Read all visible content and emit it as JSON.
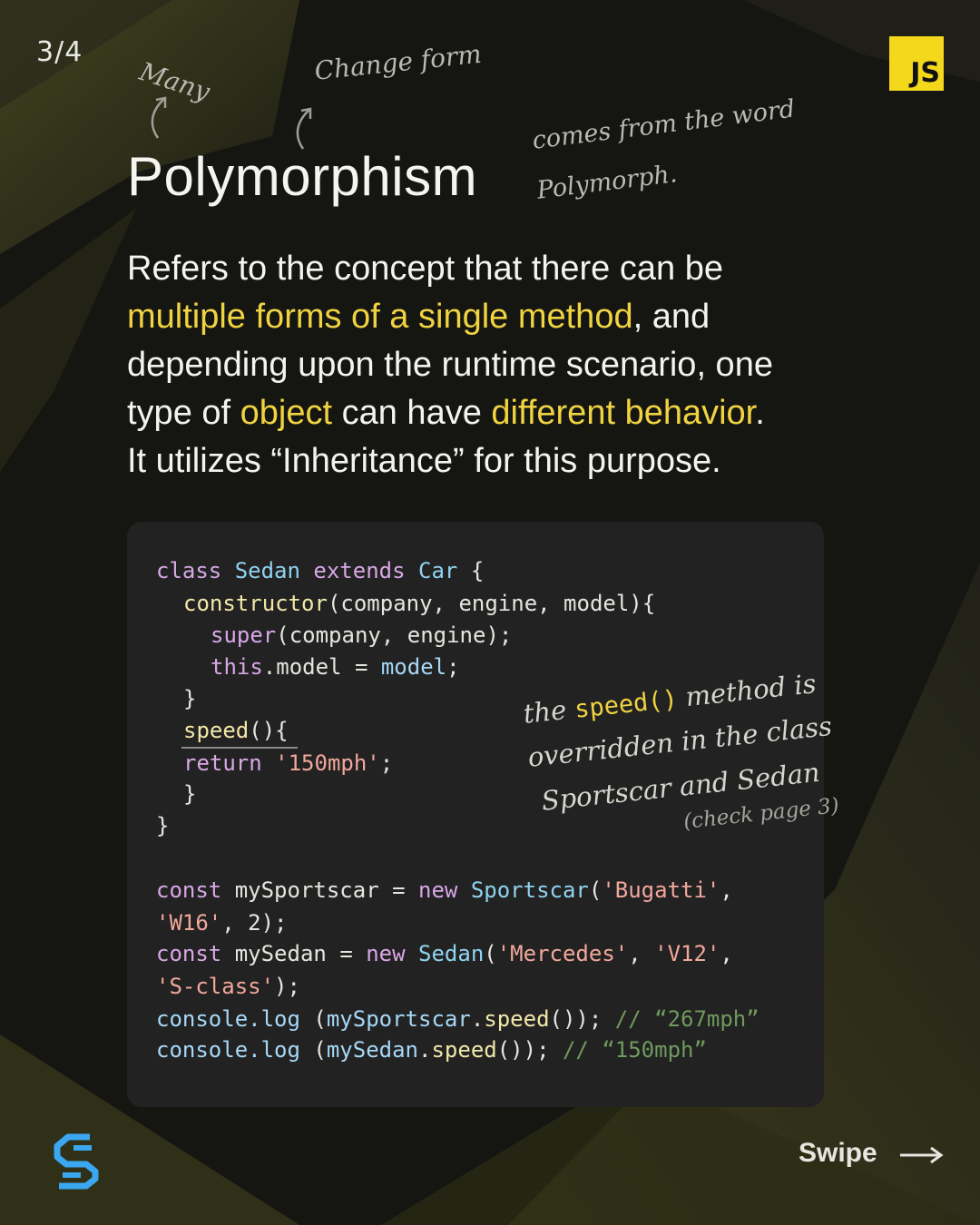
{
  "page_indicator": "3/4",
  "badge": "JS",
  "annotations": {
    "many": "Many",
    "change_form": "Change form",
    "origin_line1": "comes from the word",
    "origin_line2": "Polymorph."
  },
  "title": "Polymorphism",
  "body": {
    "p1": "Refers to the concept that there can be",
    "h1": "multiple forms of a single method",
    "p2": ", and",
    "p3": "depending upon the runtime scenario, one",
    "p4": "type of ",
    "h2": "object",
    "p5": " can have ",
    "h3": "different behavior",
    "p6": ".",
    "p7": "It utilizes “Inheritance” for this purpose."
  },
  "code": {
    "kw_class": "class",
    "name_sedan": "Sedan",
    "kw_extends": "extends",
    "name_car": "Car",
    "brace_open": "{",
    "fn_constructor": "constructor",
    "params": "(company, engine, model){",
    "kw_super": "super",
    "super_args": "(company, engine);",
    "kw_this": "this",
    "this_rest": ".model = ",
    "var_model": "model",
    "semicolon": ";",
    "brace_close": "}",
    "fn_speed": "speed",
    "speed_parens": "(){",
    "kw_return": "return",
    "str_150": "'150mph'",
    "kw_const": "const",
    "var_mysportscar": "mySportscar",
    "op_assign": "=",
    "kw_new": "new",
    "cls_sportscar": "Sportscar",
    "str_bugatti": "'Bugatti'",
    "str_w16": "'W16'",
    "num_tail": ", 2);",
    "var_mysedan": "mySedan",
    "str_mercedes": "'Mercedes'",
    "str_v12": "'V12'",
    "str_sclass": "'S-class'",
    "close_call": ");",
    "console_log": "console.log",
    "speed_call": "speed",
    "call_tail": "());",
    "comment_267": "// “267mph”",
    "comment_150": "// “150mph”"
  },
  "code_note": {
    "line1_a": "the ",
    "line1_code": "speed()",
    "line1_b": " method is",
    "line2": "overridden in the class",
    "line3": "Sportscar and Sedan",
    "line4": "(check page 3)"
  },
  "footer": {
    "swipe": "Swipe",
    "logo_icon": "s-logo-icon",
    "arrow_icon": "arrow-right-icon"
  },
  "colors": {
    "accent": "#f0d340",
    "badge_bg": "#f3d81c",
    "card_bg": "#222222",
    "logo": "#3aa7f0"
  }
}
